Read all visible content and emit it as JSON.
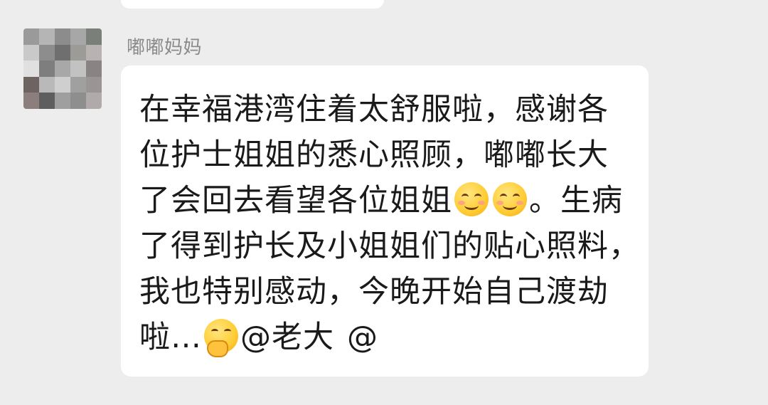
{
  "chat": {
    "sender_name": "嘟嘟妈妈",
    "message_lines": [
      "在幸福港湾住着太舒服啦，感谢各",
      "位护士姐姐的悉心照顾，嘟嘟长大",
      "了会回去看望各位姐姐",
      "。生病",
      "了得到护长及小姐姐们的贴心照料，",
      "我也特别感动，今晚开始自己渡劫",
      "啦…",
      "@老大",
      "@"
    ],
    "emojis": [
      "smiling-face-with-smiling-eyes-icon",
      "smiling-face-with-smiling-eyes-icon",
      "face-with-hand-over-mouth-icon"
    ]
  },
  "colors": {
    "background": "#ededed",
    "bubble": "#ffffff",
    "sender_name": "#8a8a8a",
    "text": "#1a1a1a"
  }
}
